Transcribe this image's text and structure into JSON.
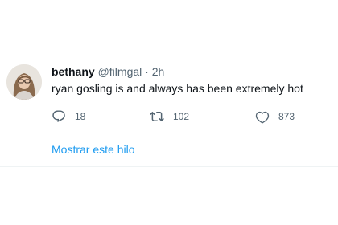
{
  "tweet": {
    "display_name": "bethany",
    "handle": "@filmgal",
    "separator": "·",
    "timestamp": "2h",
    "text": "ryan gosling is and always has been extremely hot",
    "actions": {
      "reply_count": "18",
      "retweet_count": "102",
      "like_count": "873"
    },
    "show_thread_label": "Mostrar este hilo"
  },
  "icons": {
    "reply": "reply-bubble-icon",
    "retweet": "retweet-arrows-icon",
    "like": "heart-outline-icon"
  },
  "colors": {
    "text_primary": "#0f1419",
    "text_secondary": "#536471",
    "link": "#1d9bf0",
    "divider": "#eff3f4"
  }
}
